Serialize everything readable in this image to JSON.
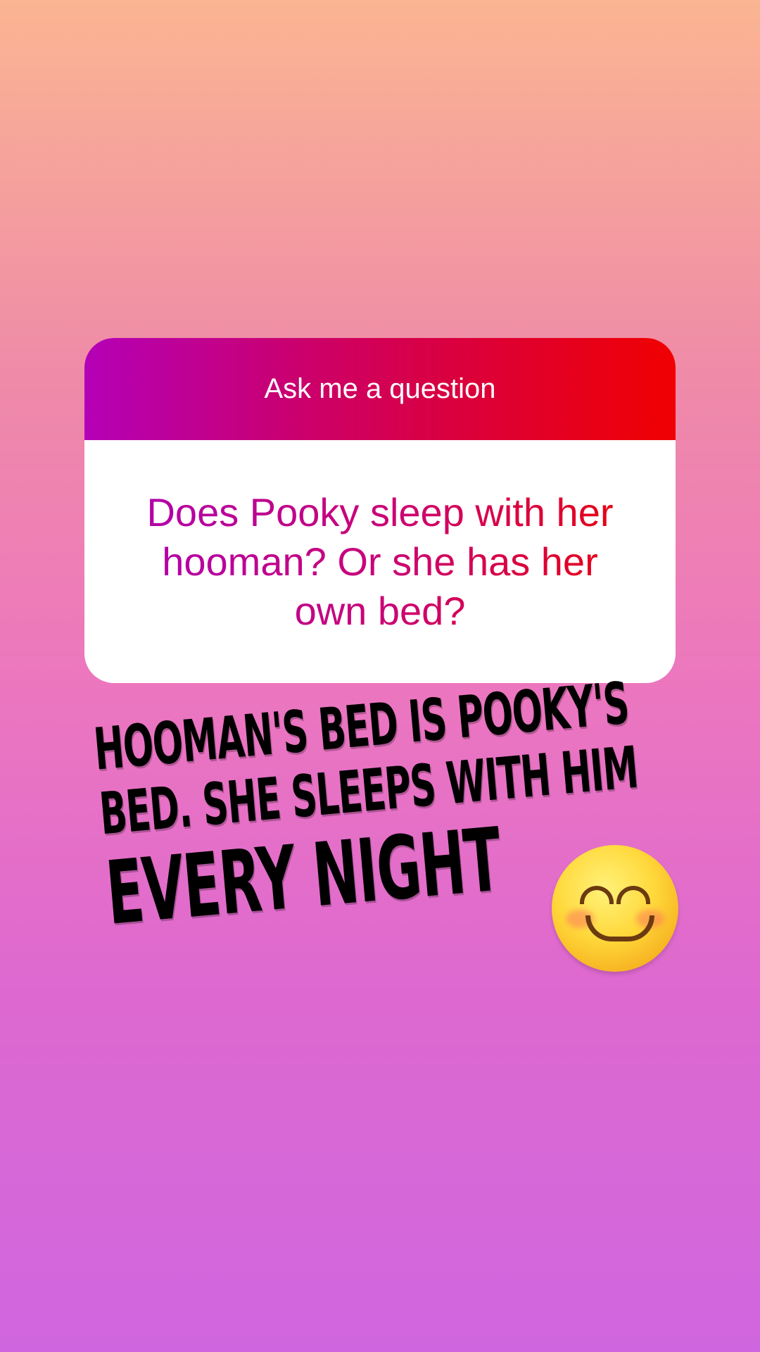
{
  "question_sticker": {
    "header": "Ask me a question",
    "question": "Does Pooky sleep with her hooman? Or she has her own bed?",
    "colors": {
      "header_gradient_start": "#B400B7",
      "header_gradient_end": "#F00000",
      "body_background": "#FFFFFF"
    }
  },
  "answer": {
    "lines": [
      "HOOMAN'S BED IS POOKY'S",
      "BED. SHE SLEEPS WITH HIM",
      "EVERY NIGHT"
    ],
    "color": "#000000"
  },
  "emoji": {
    "icon": "smiling-face-with-smiling-eyes-icon"
  },
  "background": {
    "gradient_top": "#FBB592",
    "gradient_bottom": "#D066DF"
  }
}
